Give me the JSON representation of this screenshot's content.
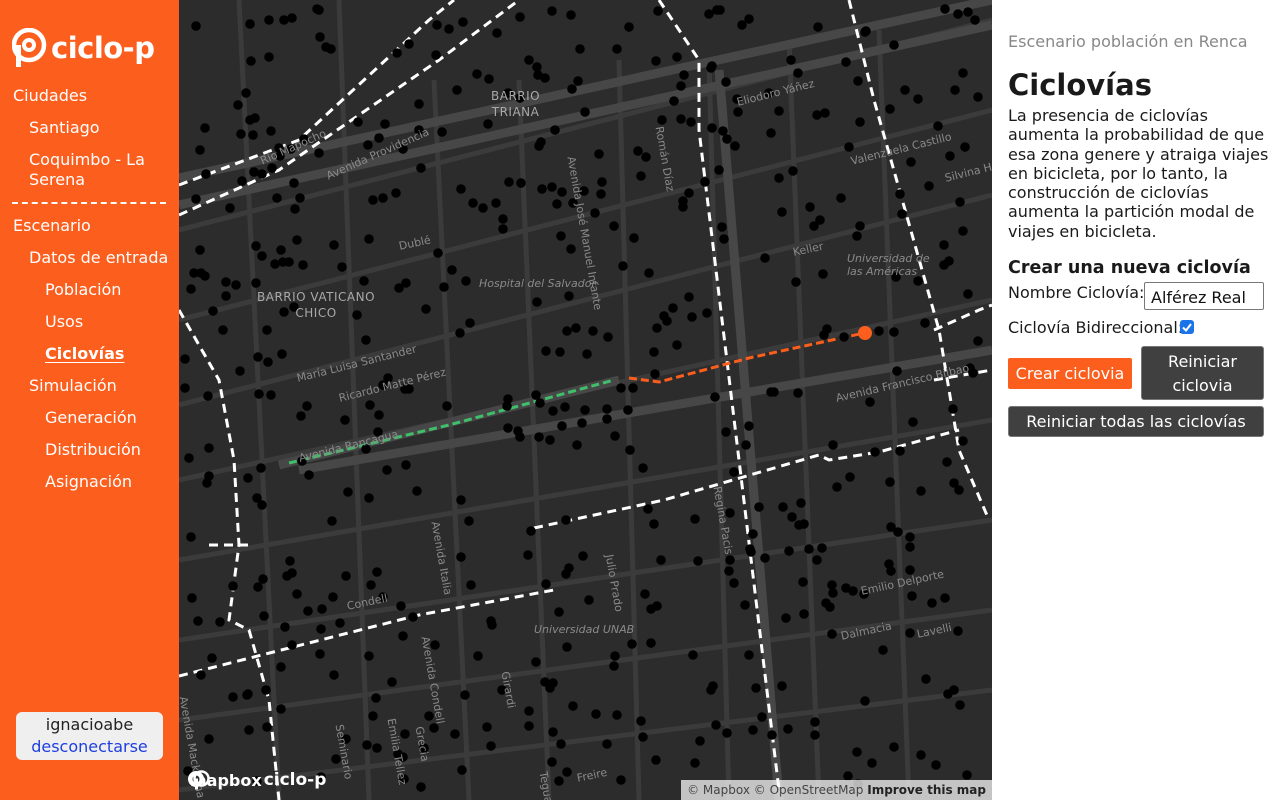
{
  "sidebar": {
    "brand": "ciclo-p",
    "nav": {
      "cities_header": "Ciudades",
      "city_santiago": "Santiago",
      "city_coquimbo_1": "Coquimbo - La",
      "city_coquimbo_2": "Serena",
      "scenario_header": "Escenario",
      "input_data": "Datos de entrada",
      "population": "Población",
      "uses": "Usos",
      "bikeways": "Ciclovías",
      "simulation": "Simulación",
      "generation": "Generación",
      "distribution": "Distribución",
      "assignment": "Asignación"
    },
    "user": {
      "name": "ignacioabe",
      "logout": "desconectarse"
    }
  },
  "map": {
    "labels": {
      "barrio_triana_1": "BARRIO",
      "barrio_triana_2": "TRIANA",
      "barrio_vaticano_1": "BARRIO VATICANO",
      "barrio_vaticano_2": "CHICO",
      "hospital": "Hospital del Salvador",
      "univ_americas_1": "Universidad de",
      "univ_americas_2": "las Américas",
      "univ_unab": "Universidad UNAB",
      "eliodoro": "Eliodoro Yáñez",
      "valenzuela": "Valenzuela Castillo",
      "silvina": "Silvina Hurtado",
      "rio_mapocho": "Río Mapocho",
      "providencia": "Avenida Providencia",
      "av_francisco": "Avenida Francisco Bilbao",
      "av_rancagua": "Avenida Rancagua",
      "ricardo": "Ricardo Matte Pérez",
      "maria_luisa": "María Luisa Santander",
      "emilio": "Emilio Delporte",
      "keller": "Keller",
      "dublin": "Dublé",
      "condell": "Condell",
      "dalmacia": "Dalmacia",
      "lavelli": "Lavelli",
      "mackenna": "Avenida Mackenna",
      "jose_manuel": "Avenida José Manuel Infante",
      "guzman": "Román Díaz",
      "italia": "Avenida Italia",
      "girardi": "Girardi",
      "julio_prado": "Julio Prado",
      "regina": "Regina Pacis",
      "freire": "Freire",
      "tegualda": "Tegualda",
      "emilia": "Emilia Tellez",
      "condell2": "Avenida Condell",
      "seminario": "Seminario",
      "grecia": "Grecia"
    },
    "logo_mapbox": "mapbox",
    "logo_ciclop": "ciclo-p",
    "attribution": "© Mapbox © OpenStreetMap",
    "improve": "Improve this map",
    "colors": {
      "background": "#2c2c2c",
      "roads": "#3d3d3d",
      "major_roads": "#464646",
      "bike_routes": "#ffffff",
      "new_segment": "#fb5e1d",
      "existing_segment": "#3fbf6a",
      "nodes": "#000000"
    }
  },
  "panel": {
    "scenario": "Escenario población en Renca",
    "title": "Ciclovías",
    "description": "La presencia de ciclovías aumenta la probabilidad de que esa zona genere y atraiga viajes en bicicleta, por lo tanto, la construcción de ciclovías aumenta la partición modal de viajes en bicicleta.",
    "form_title": "Crear una nueva ciclovía",
    "name_label": "Nombre Ciclovía:",
    "name_value": "Alférez Real",
    "bidirectional_label": "Ciclovía Bidireccional:",
    "bidirectional_checked": true,
    "create_button": "Crear ciclovia",
    "reset_button_1": "Reiniciar",
    "reset_button_2": "ciclovia",
    "reset_all_button": "Reiniciar todas las ciclovías"
  }
}
